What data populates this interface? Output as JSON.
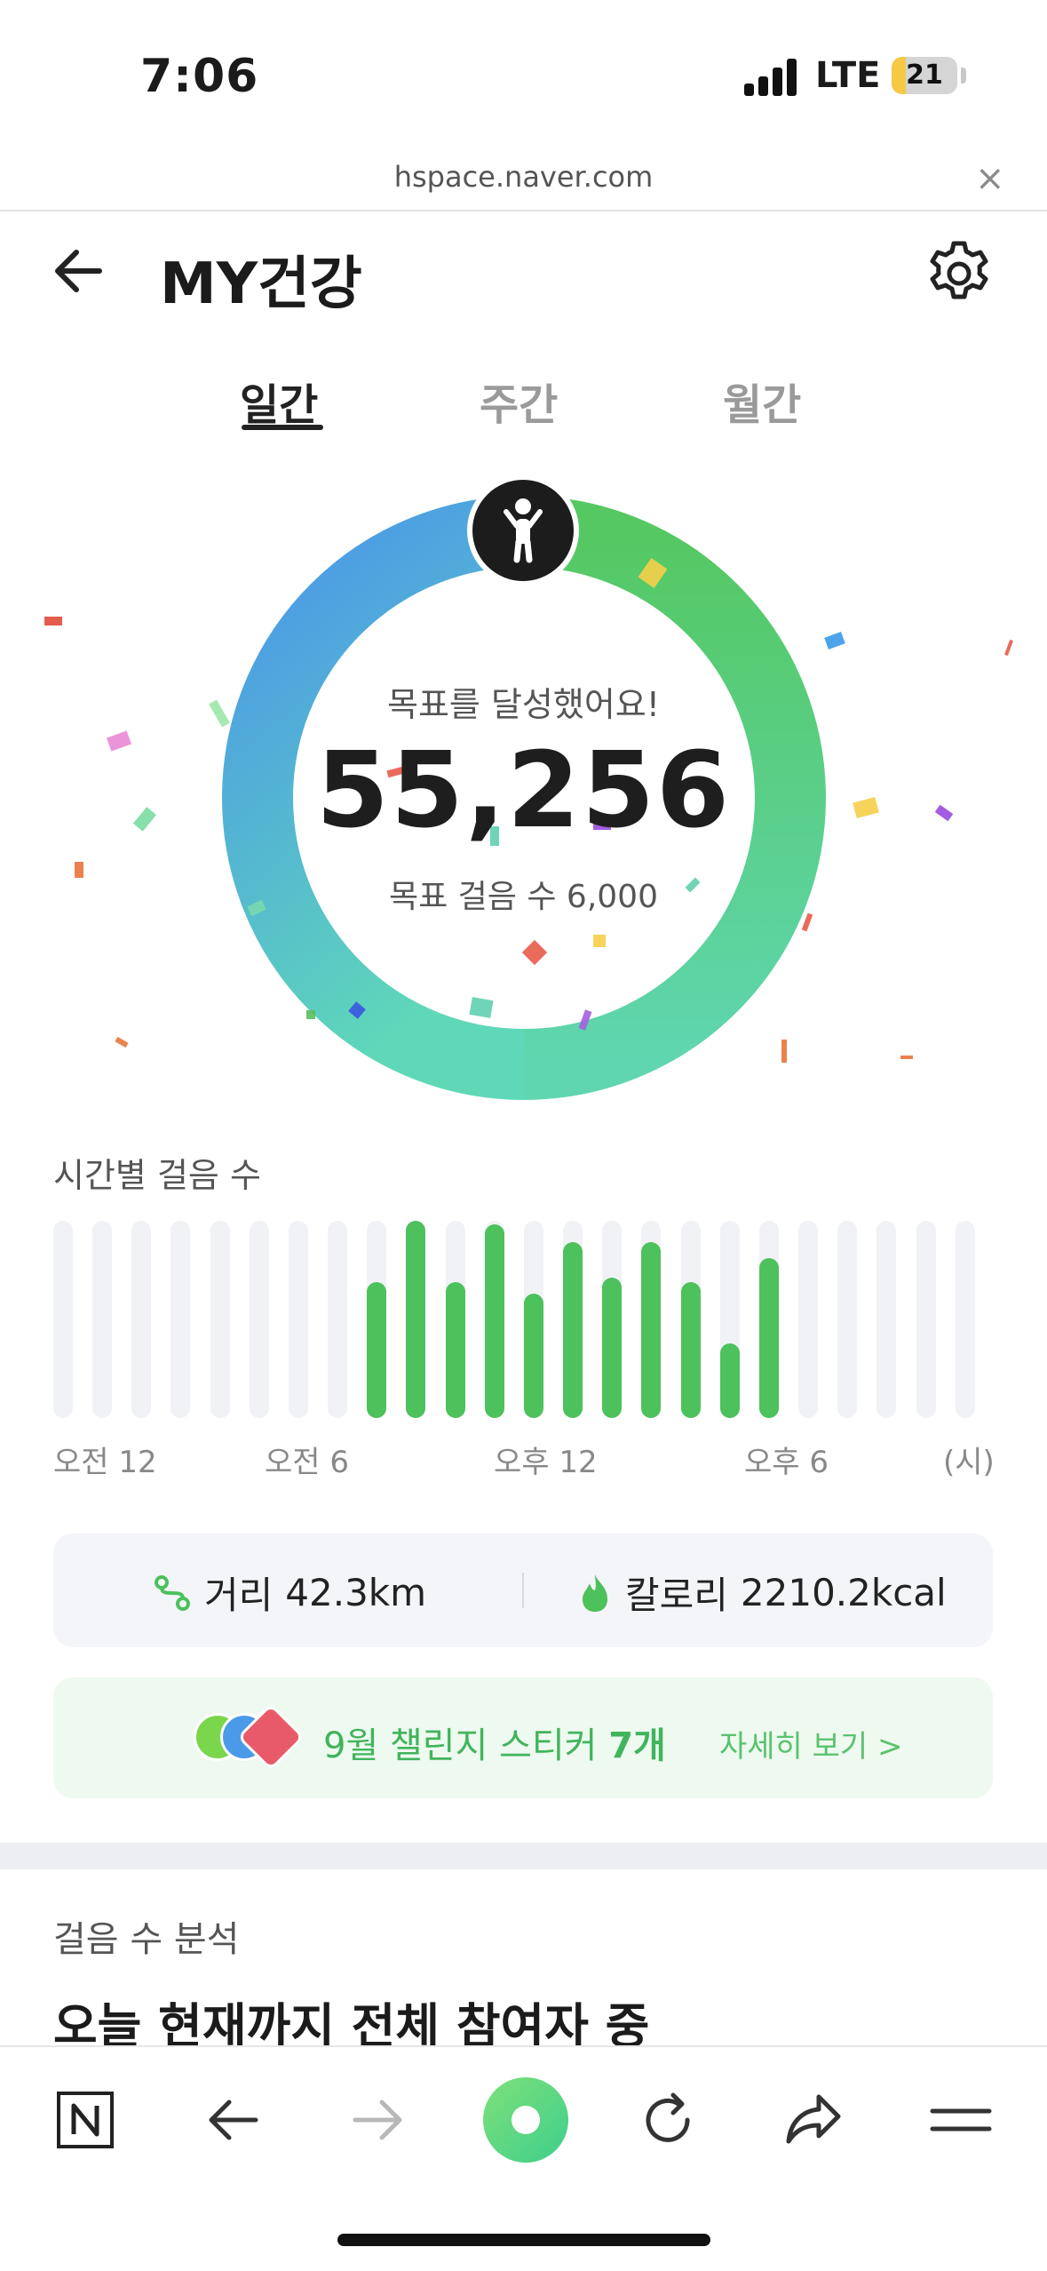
{
  "status_bar": {
    "time": "7:06",
    "network": "LTE",
    "battery": "21",
    "battery_level": 0.21
  },
  "browser": {
    "url": "hspace.naver.com",
    "close_icon": "×"
  },
  "header": {
    "title": "MY건강"
  },
  "tabs": [
    {
      "label": "일간",
      "active": true
    },
    {
      "label": "주간",
      "active": false
    },
    {
      "label": "월간",
      "active": false
    }
  ],
  "summary": {
    "goal_message": "목표를 달성했어요!",
    "steps": "55,256",
    "goal_label": "목표 걸음 수 6,000"
  },
  "hourly": {
    "title": "시간별 걸음 수",
    "axis_labels": [
      "오전 12",
      "오전 6",
      "오후 12",
      "오후 6",
      "(시)"
    ],
    "bar_levels": [
      0,
      0,
      0,
      0,
      0,
      0,
      0,
      0,
      0.69,
      1.0,
      0.69,
      0.98,
      0.63,
      0.89,
      0.71,
      0.89,
      0.69,
      0.38,
      0.81,
      0,
      0,
      0,
      0,
      0
    ],
    "accent": "#4cc15c",
    "track_color": "#f1f2f6"
  },
  "stats": {
    "distance_label": "거리",
    "distance_value": "42.3km",
    "calorie_label": "칼로리",
    "calorie_value": "2210.2kcal"
  },
  "challenge": {
    "text": "9월 챌린지 스티커",
    "count": "7개",
    "link": "자세히 보기 >"
  },
  "analysis": {
    "title": "걸음 수 분석",
    "heading": "오늘 현재까지 전체 참여자 중"
  },
  "colors": {
    "ring_start": "#4a9be8",
    "ring_mid": "#5fd39a",
    "ring_end": "#5dcd6a"
  }
}
